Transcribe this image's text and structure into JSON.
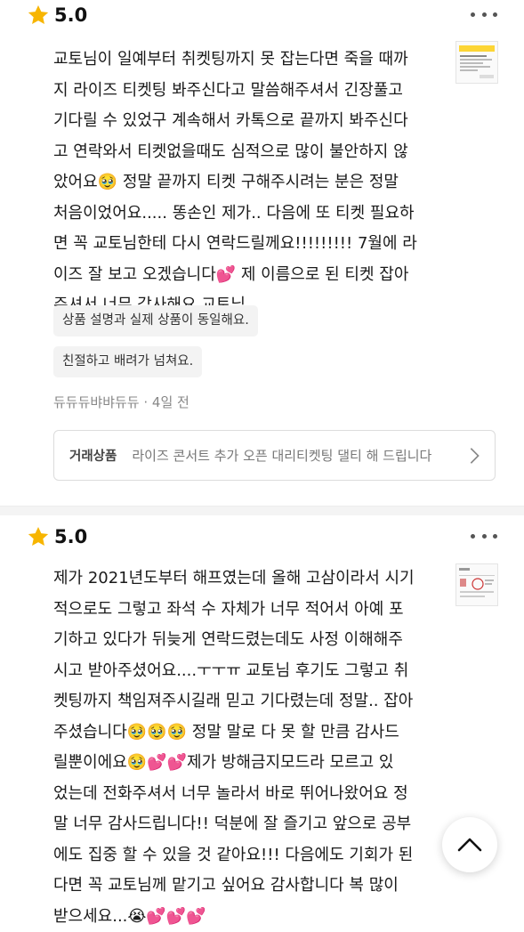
{
  "reviews": [
    {
      "rating": "5.0",
      "body": "교토님이 일예부터 취켓팅까지 못 잡는다면 죽을 때까\n지 라이즈 티켓팅 봐주신다고 말씀해주셔서 긴장풀고\n기다릴 수 있었구 계속해서 카톡으로 끝까지 봐주신다\n고 연락와서 티켓없을때도 심적으로 많이 불안하지 않\n았어요🥹 정말 끝까지 티켓 구해주시려는 분은 정말\n처음이었어요..... 똥손인 제가.. 다음에 또 티켓 필요하\n면 꼭 교토님한테 다시 연락드릴께요!!!!!!!!! 7월에 라\n이즈 잘 보고 오겠습니다💕 제 이름으로 된 티켓 잡아\n주셔서 너무 감사해요 교토님",
      "tags": [
        "상품 설명과 실제 상품이 동일해요.",
        "친절하고 배려가 넘쳐요."
      ],
      "author": "듀듀듀뱌뱌듀듀",
      "time": "· 4일 전",
      "product_label": "거래상품",
      "product_title": "라이즈 콘서트 추가 오픈 대리티켓팅 댈티 해 드립니다"
    },
    {
      "rating": "5.0",
      "body": "제가 2021년도부터 해프였는데 올해 고삼이라서 시기\n적으로도 그렇고 좌석 수 자체가 너무 적어서 아예 포\n기하고 있다가 뒤늦게 연락드렸는데도 사정 이해해주\n시고 받아주셨어요....ㅜㅜㅠ 교토님 후기도 그렇고 취\n켓팅까지 책임져주시길래 믿고 기다렸는데 정말.. 잡아\n주셨습니다🥹🥹🥹 정말 말로 다 못 할 만큼 감사드\n릴뿐이에요🥹💕💕제가 방해금지모드라 모르고 있\n었는데 전화주셔서 너무 놀라서 바로 뛰어나왔어요 정\n말 너무 감사드립니다!! 덕분에 잘 즐기고 앞으로 공부\n에도 집중 할 수 있을 것 같아요!!! 다음에도 기회가 된\n다면 꼭 교토님께 맡기고 싶어요 감사합니다 복 많이\n받으세요...😭💕💕💕"
    }
  ],
  "colors": {
    "star": "#f7b500",
    "accent": "#fcd535",
    "divider": "#f4f4f4"
  },
  "icons": [
    "star-icon",
    "more-icon",
    "chevron-right-icon",
    "chevron-up-icon"
  ]
}
